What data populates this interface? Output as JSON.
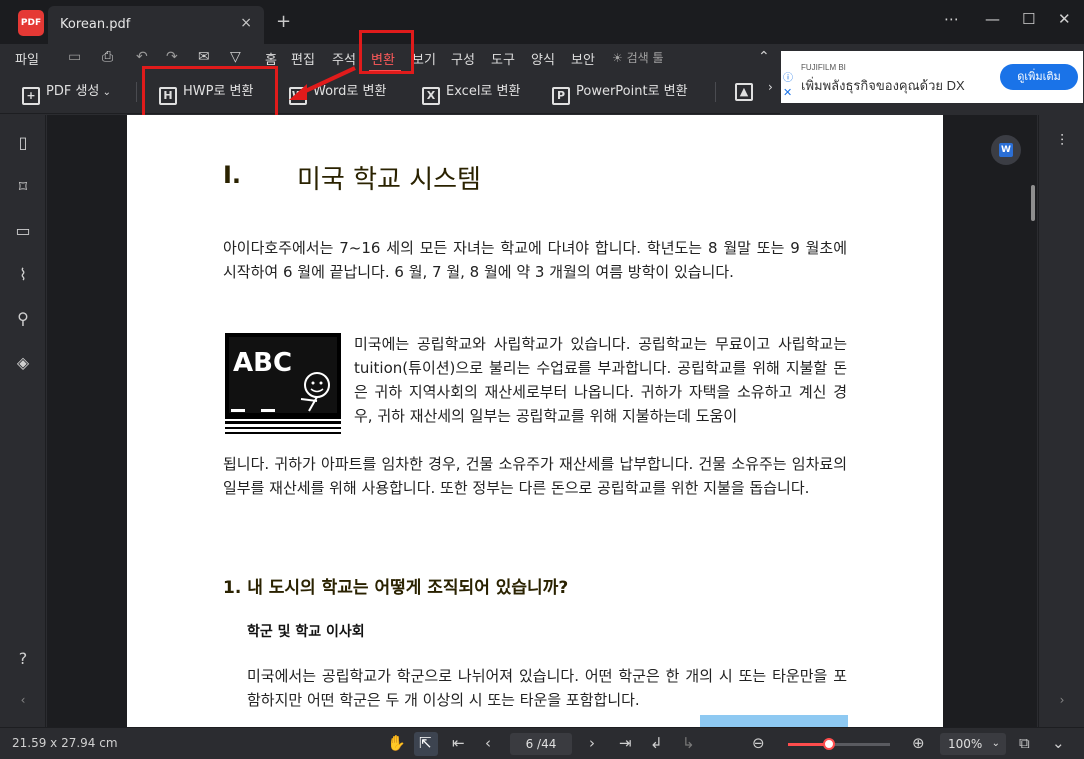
{
  "app": {
    "logo_text": "PDF"
  },
  "tab": {
    "title": "Korean.pdf",
    "close": "×",
    "new": "+"
  },
  "window_controls": {
    "more": "⋯",
    "min": "—",
    "max": "☐",
    "close": "✕"
  },
  "menu": {
    "file": "파일",
    "items": [
      "홈",
      "편집",
      "주석",
      "변환",
      "보기",
      "구성",
      "도구",
      "양식",
      "보안"
    ],
    "search_tools": "검색 툴"
  },
  "toolbar": {
    "create_pdf": "PDF 생성",
    "hwp": "HWP로 변환",
    "word": "Word로 변환",
    "excel": "Excel로 변환",
    "powerpoint": "PowerPoint로 변환"
  },
  "ad": {
    "brand": "FUJIFILM BI",
    "text": "เพิ่มพลังธุรกิจของคุณด้วย DX",
    "button": "ดูเพิ่มเติม"
  },
  "document": {
    "heading_num": "I.",
    "heading_text": "미국 학교 시스템",
    "p1": "아이다호주에서는 7~16 세의 모든 자녀는 학교에 다녀야 합니다. 학년도는 8 월말 또는 9 월초에 시작하여 6 월에 끝납니다. 6 월, 7 월, 8 월에 약 3 개월의 여름 방학이 있습니다.",
    "p2a": "미국에는 공립학교와 사립학교가 있습니다. 공립학교는 무료이고 사립학교는 tuition(튜이션)으로 불리는 수업료를 부과합니다. 공립학교를 위해 지불할 돈은 귀하 지역사회의 재산세로부터 나옵니다. 귀하가 자택을 소유하고 계신 경우, 귀하 재산세의 일부는 공립학교를 위해 지불하는데 도움이",
    "p2b": "됩니다. 귀하가 아파트를 임차한 경우, 건물 소유주가 재산세를 납부합니다. 건물 소유주는 임차료의 일부를 재산세를 위해 사용합니다. 또한 정부는 다른 돈으로 공립학교를 위한 지불을 돕습니다.",
    "chalk_text": "ABC",
    "h2": "1. 내 도시의 학교는 어떻게 조직되어 있습니까?",
    "h3": "학군 및 학교 이사회",
    "p3": "미국에서는 공립학교가 학군으로 나뉘어져 있습니다. 어떤 학군은 한 개의 시 또는 타운만을 포함하지만 어떤 학군은 두 개 이상의 시 또는 타운을 포함합니다."
  },
  "status": {
    "page_size": "21.59 x 27.94 cm",
    "page_indicator": "6 /44",
    "zoom": "100%",
    "zoom_level": 0.4
  },
  "colors": {
    "highlight": "#e01b1b",
    "accent": "#ff4d4d",
    "ad_button": "#1a73e8"
  }
}
